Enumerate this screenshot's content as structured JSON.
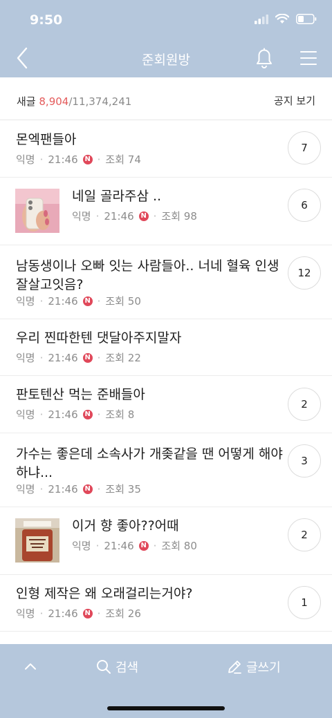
{
  "status": {
    "time": "9:50"
  },
  "nav": {
    "title": "준회원방"
  },
  "counts": {
    "label": "새글",
    "new": "8,904",
    "total": "/11,374,241",
    "notice": "공지 보기"
  },
  "posts": [
    {
      "title": "몬엑팬들아",
      "author": "익명",
      "time": "21:46",
      "badge": "N",
      "views": "조회 74",
      "comments": "7"
    },
    {
      "title": "네일 골라주삼 ..",
      "author": "익명",
      "time": "21:46",
      "badge": "N",
      "views": "조회 98",
      "comments": "6"
    },
    {
      "title": "남동생이나 오빠 잇는 사람들아.. 너네 혈육 인생",
      "title2": "잘살고잇음?",
      "author": "익명",
      "time": "21:46",
      "badge": "N",
      "views": "조회 50",
      "comments": "12"
    },
    {
      "title": "우리 찐따한텐 댓달아주지말자",
      "author": "익명",
      "time": "21:46",
      "badge": "N",
      "views": "조회 22"
    },
    {
      "title": "판토텐산 먹는 준배들아",
      "author": "익명",
      "time": "21:46",
      "badge": "N",
      "views": "조회 8",
      "comments": "2"
    },
    {
      "title": "가수는 좋은데 소속사가 개좆같을 땐 어떻게 해야",
      "title2": "하냐...",
      "author": "익명",
      "time": "21:46",
      "badge": "N",
      "views": "조회 35",
      "comments": "3"
    },
    {
      "title": "이거 향 좋아??어때",
      "author": "익명",
      "time": "21:46",
      "badge": "N",
      "views": "조회 80",
      "comments": "2"
    },
    {
      "title": "인형 제작은 왜 오래걸리는거야?",
      "author": "익명",
      "time": "21:46",
      "badge": "N",
      "views": "조회 26",
      "comments": "1"
    }
  ],
  "bottom": {
    "search": "검색",
    "write": "글쓰기"
  }
}
